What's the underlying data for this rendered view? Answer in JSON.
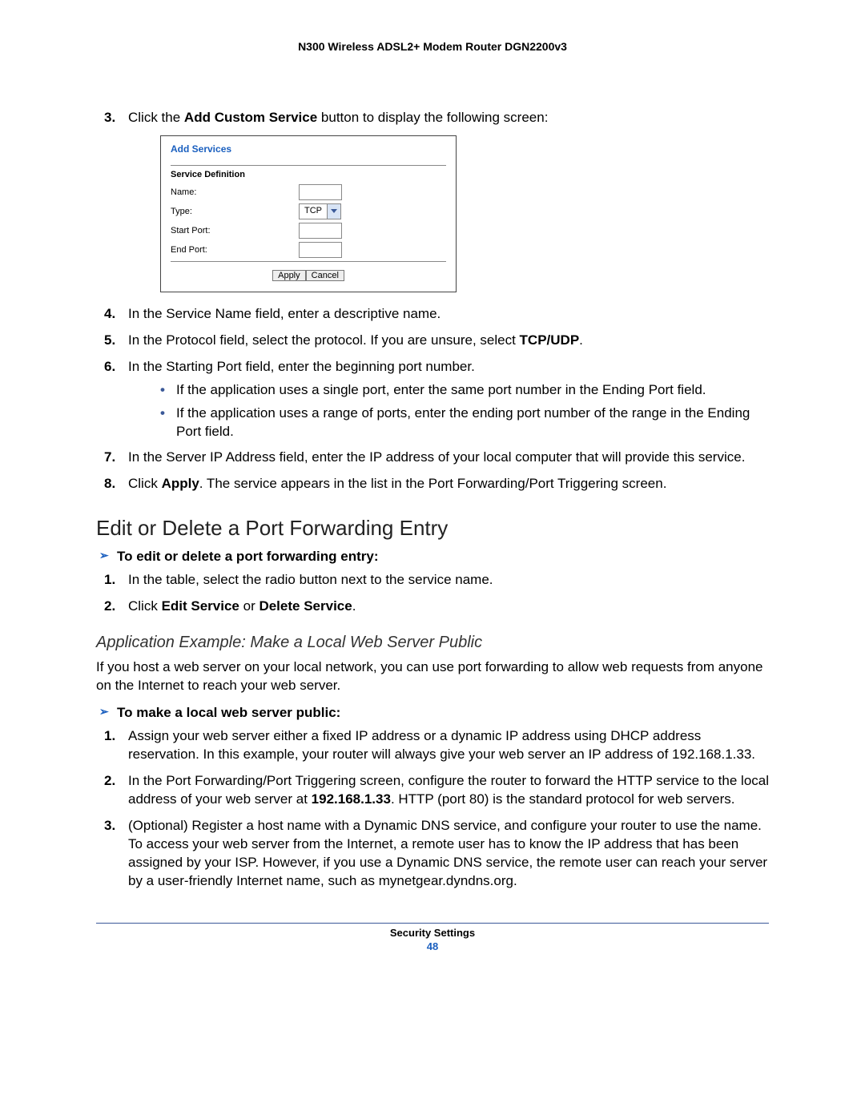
{
  "header": {
    "title": "N300 Wireless ADSL2+ Modem Router DGN2200v3"
  },
  "step3": {
    "num": "3.",
    "pre": "Click the ",
    "bold": "Add Custom Service",
    "post": " button to display the following screen:"
  },
  "panel": {
    "title": "Add Services",
    "svc_def": "Service Definition",
    "name_lbl": "Name:",
    "type_lbl": "Type:",
    "type_val": "TCP",
    "start_lbl": "Start Port:",
    "end_lbl": "End Port:",
    "apply": "Apply",
    "cancel": "Cancel"
  },
  "step4": {
    "num": "4.",
    "text": "In the Service Name field, enter a descriptive name."
  },
  "step5": {
    "num": "5.",
    "pre": "In the Protocol field, select the protocol. If you are unsure, select ",
    "bold": "TCP/UDP",
    "post": "."
  },
  "step6": {
    "num": "6.",
    "text": "In the Starting Port field, enter the beginning port number.",
    "b1": "If the application uses a single port, enter the same port number in the Ending Port field.",
    "b2": "If the application uses a range of ports, enter the ending port number of the range in the Ending Port field."
  },
  "step7": {
    "num": "7.",
    "text": "In the Server IP Address field, enter the IP address of your local computer that will provide this service."
  },
  "step8": {
    "num": "8.",
    "pre": "Click ",
    "bold": "Apply",
    "post": ". The service appears in the list in the Port Forwarding/Port Triggering screen."
  },
  "sectionA": {
    "title": "Edit or Delete a Port Forwarding Entry",
    "proc": "To edit or delete a port forwarding entry:",
    "s1": {
      "num": "1.",
      "text": "In the table, select the radio button next to the service name."
    },
    "s2": {
      "num": "2.",
      "pre": "Click ",
      "b1": "Edit Service",
      "mid": " or ",
      "b2": "Delete Service",
      "post": "."
    }
  },
  "sectionB": {
    "title": "Application Example: Make a Local Web Server Public",
    "intro": "If you host a web server on your local network, you can use port forwarding to allow web requests from anyone on the Internet to reach your web server.",
    "proc": "To make a local web server public:",
    "s1": {
      "num": "1.",
      "text": "Assign your web server either a fixed IP address or a dynamic IP address using DHCP address reservation. In this example, your router will always give your web server an IP address of 192.168.1.33."
    },
    "s2": {
      "num": "2.",
      "pre": "In the Port Forwarding/Port Triggering screen, configure the router to forward the HTTP service to the local address of your web server at ",
      "bold": "192.168.1.33",
      "post": ". HTTP (port 80) is the standard protocol for web servers."
    },
    "s3": {
      "num": "3.",
      "text": "(Optional) Register a host name with a Dynamic DNS service, and configure your router to use the name. To access your web server from the Internet, a remote user has to know the IP address that has been assigned by your ISP. However, if you use a Dynamic DNS service, the remote user can reach your server by a user-friendly Internet name, such as mynetgear.dyndns.org."
    }
  },
  "footer": {
    "section": "Security Settings",
    "page": "48"
  }
}
